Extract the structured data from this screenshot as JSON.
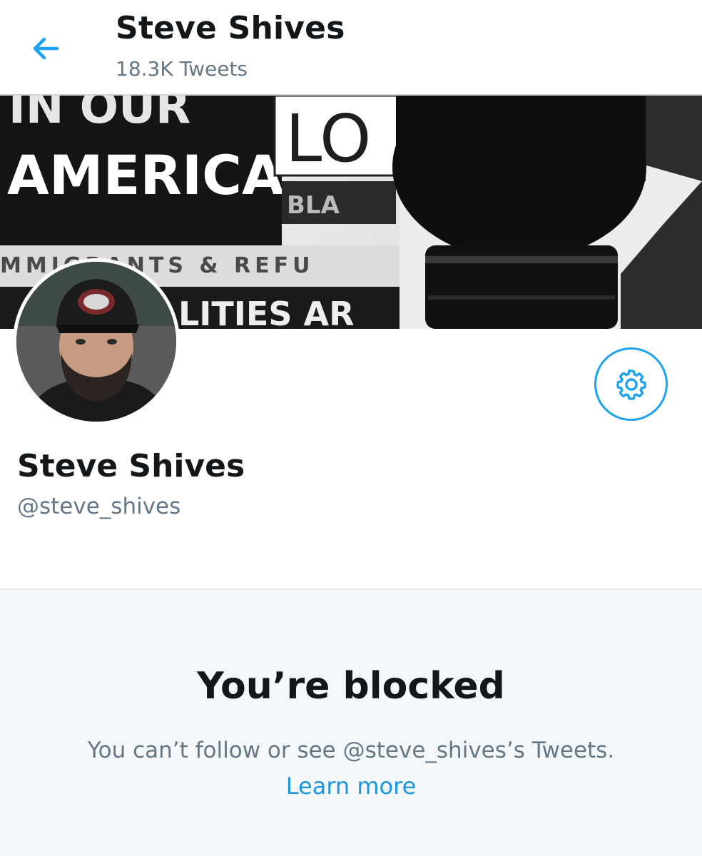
{
  "header": {
    "title": "Steve Shives",
    "subtitle": "18.3K Tweets",
    "back_icon": "arrow-left-icon"
  },
  "banner": {
    "line1": "IN OUR",
    "line2": "AMERICA",
    "line3": "MMIGRANTS & REFU",
    "line4": "LITIES AR",
    "box_text": "LO",
    "box_sub": "BLA"
  },
  "profile": {
    "display_name": "Steve Shives",
    "handle": "@steve_shives",
    "settings_icon": "gear-icon"
  },
  "blocked": {
    "title": "You’re blocked",
    "message": "You can’t follow or see @steve_shives’s Tweets.",
    "learn_more": "Learn more"
  },
  "colors": {
    "accent": "#1da1f2",
    "link": "#1b95e0",
    "muted": "#657786",
    "text": "#14171a",
    "panel_bg": "#f5f8fa"
  }
}
